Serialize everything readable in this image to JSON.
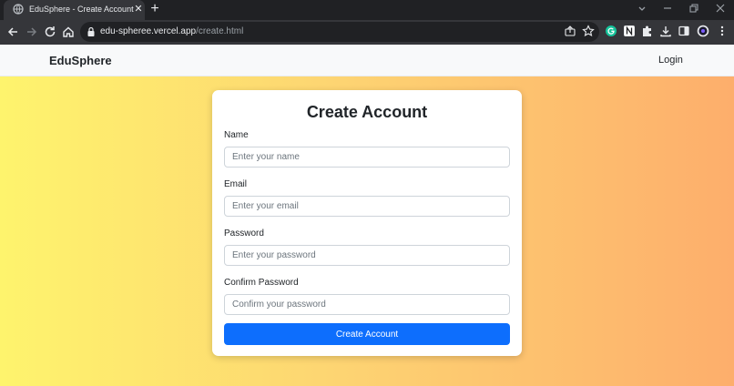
{
  "browser": {
    "tab_title": "EduSphere - Create Account",
    "tab_close": "✕",
    "new_tab": "+",
    "url_host": "edu-spheree.vercel.app",
    "url_path": "/create.html"
  },
  "navbar": {
    "brand": "EduSphere",
    "login": "Login"
  },
  "form": {
    "title": "Create Account",
    "fields": [
      {
        "label": "Name",
        "placeholder": "Enter your name",
        "value": ""
      },
      {
        "label": "Email",
        "placeholder": "Enter your email",
        "value": ""
      },
      {
        "label": "Password",
        "placeholder": "Enter your password",
        "value": ""
      },
      {
        "label": "Confirm Password",
        "placeholder": "Confirm your password",
        "value": ""
      }
    ],
    "submit": "Create Account"
  },
  "colors": {
    "gradient_start": "#fef46d",
    "gradient_end": "#fdae6c",
    "button": "#0d6efd",
    "navbar_bg": "#f8f9fa"
  }
}
